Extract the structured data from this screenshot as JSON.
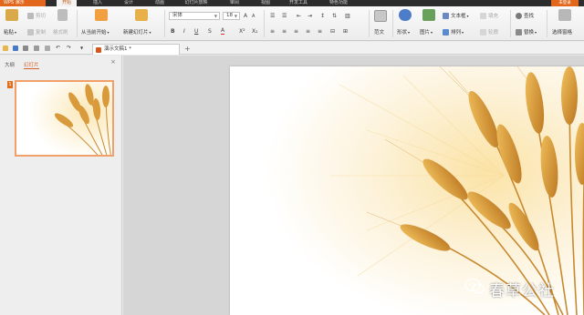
{
  "app": {
    "name": "WPS 演示",
    "signin": "未登录"
  },
  "menu": [
    "开始",
    "插入",
    "设计",
    "动画",
    "幻灯片放映",
    "审阅",
    "视图",
    "开发工具",
    "特色功能"
  ],
  "ribbon": {
    "paste": "粘贴",
    "cut": "剪切",
    "copy": "复制",
    "format_painter": "格式刷",
    "from_current": "从当前开始",
    "new_slide": "新建幻灯片",
    "font_name": "宋体",
    "font_size": "18",
    "fan_wen": "范文",
    "shape": "形状",
    "image": "图片",
    "text_box": "文本框",
    "fill": "填充",
    "arrange": "排列",
    "outline": "轮廓",
    "find": "查找",
    "replace": "替换",
    "select_pane": "选择窗格"
  },
  "tabbar": {
    "doc_title": "演示文稿1 *"
  },
  "leftpane": {
    "tab_outline": "大纲",
    "tab_slides": "幻灯片",
    "slide_number": "1"
  },
  "watermark": {
    "text": "春草公社"
  },
  "colors": {
    "accent": "#e2661b",
    "titlebar": "#2d2d2d",
    "wheat": "#d89a3a"
  }
}
